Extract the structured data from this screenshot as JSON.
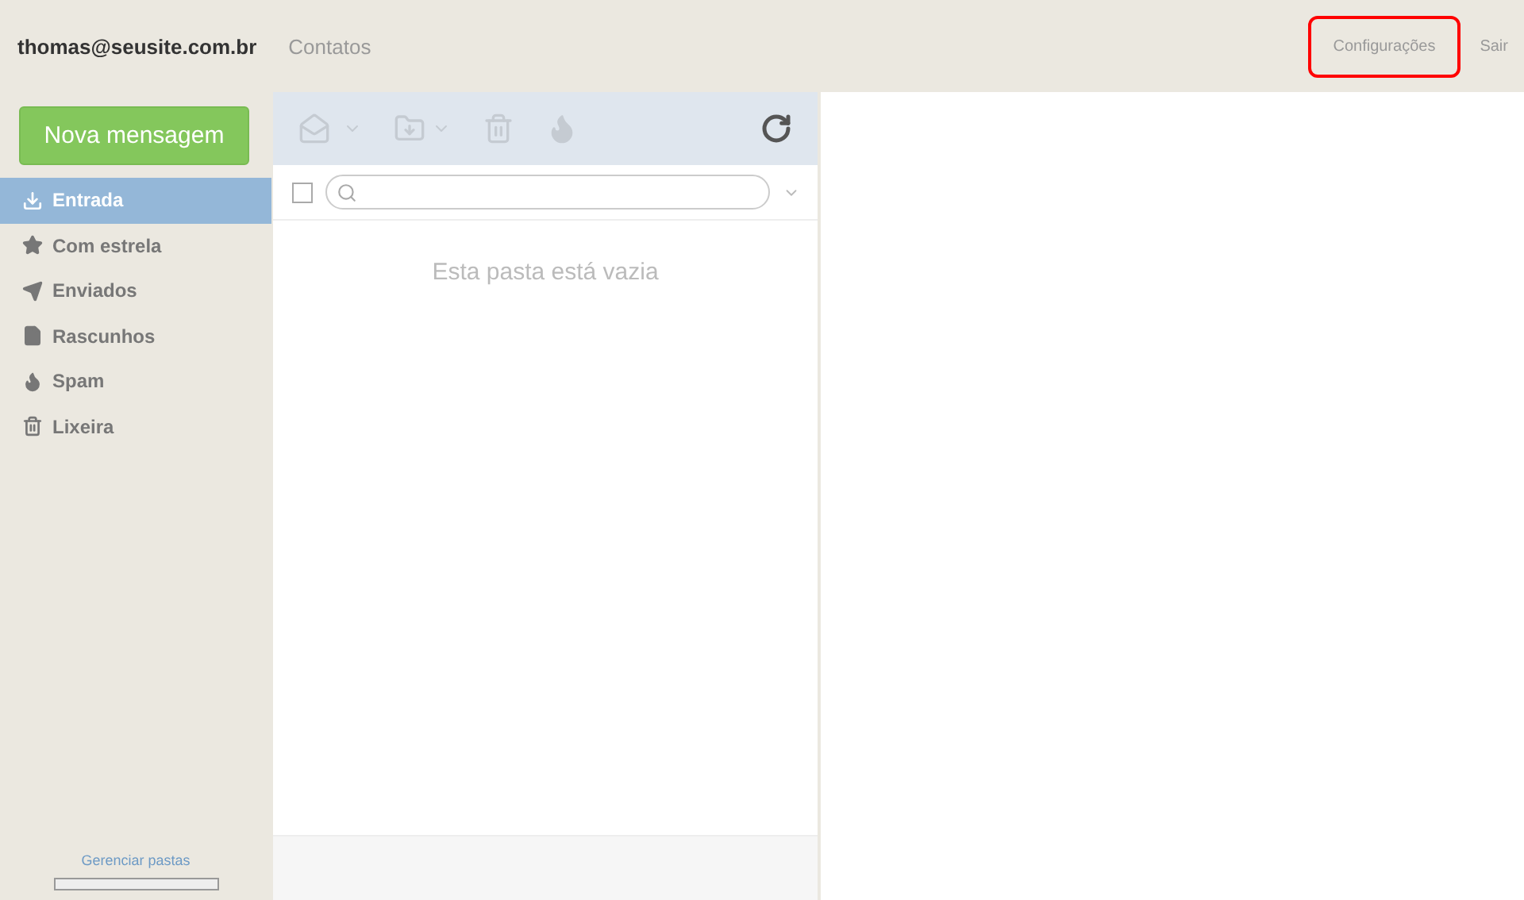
{
  "header": {
    "account": "thomas@seusite.com.br",
    "nav": [
      {
        "label": "Contatos"
      }
    ],
    "links": [
      {
        "label": "Configurações",
        "highlighted": true
      },
      {
        "label": "Sair",
        "highlighted": false
      }
    ]
  },
  "compose_button": "Nova mensagem",
  "folders": [
    {
      "label": "Entrada",
      "kind": "inbox",
      "selected": true
    },
    {
      "label": "Com estrela",
      "kind": "star",
      "selected": false
    },
    {
      "label": "Enviados",
      "kind": "sent",
      "selected": false
    },
    {
      "label": "Rascunhos",
      "kind": "drafts",
      "selected": false
    },
    {
      "label": "Spam",
      "kind": "spam",
      "selected": false
    },
    {
      "label": "Lixeira",
      "kind": "trash",
      "selected": false
    }
  ],
  "manage_folders": "Gerenciar pastas",
  "quota": {
    "level": 0
  },
  "message_list": {
    "select_all": {
      "checked": false
    },
    "empty_text": "Esta pasta está vazia"
  }
}
